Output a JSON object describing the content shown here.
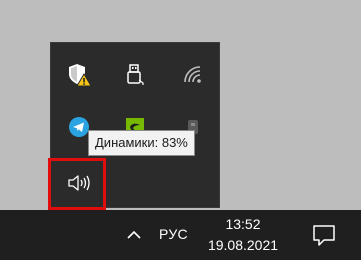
{
  "tooltip": {
    "text": "Динамики: 83%"
  },
  "taskbar": {
    "language": "РУС",
    "time": "13:52",
    "date": "19.08.2021"
  },
  "tray_icons": [
    {
      "name": "windows-security-warning-icon"
    },
    {
      "name": "usb-device-icon"
    },
    {
      "name": "wifi-icon"
    },
    {
      "name": "telegram-icon"
    },
    {
      "name": "nvidia-icon"
    },
    {
      "name": "generic-app-icon"
    },
    {
      "name": "speaker-icon"
    }
  ],
  "colors": {
    "highlight": "#e10d0d",
    "taskbar": "#1f1f1f",
    "flyout": "#2b2b2b",
    "telegram": "#2aa3e0",
    "nvidia": "#76b900",
    "security_warning": "#f5c518"
  }
}
